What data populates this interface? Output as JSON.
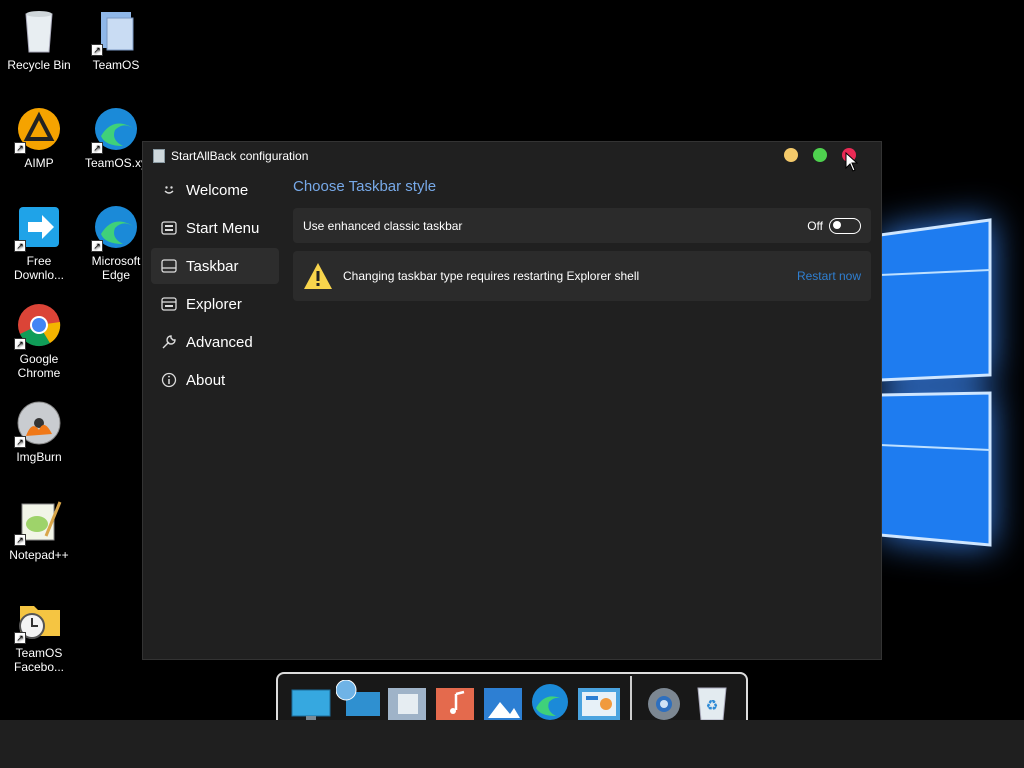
{
  "desktop": {
    "icons": [
      {
        "label": "Recycle Bin",
        "icon": "recycle-bin-icon"
      },
      {
        "label": "TeamOS",
        "icon": "teamos-icon"
      },
      {
        "label": "AIMP",
        "icon": "aimp-icon"
      },
      {
        "label": "TeamOS.xy",
        "icon": "edge-icon"
      },
      {
        "label": "Free Downlo...",
        "icon": "free-download-manager-icon"
      },
      {
        "label": "Microsoft Edge",
        "icon": "edge-icon"
      },
      {
        "label": "Google Chrome",
        "icon": "chrome-icon"
      },
      {
        "label": "ImgBurn",
        "icon": "imgburn-icon"
      },
      {
        "label": "Notepad++",
        "icon": "notepadpp-icon"
      },
      {
        "label": "TeamOS Facebo...",
        "icon": "folder-clock-icon"
      }
    ]
  },
  "window": {
    "title": "StartAllBack configuration",
    "controls": {
      "minimize": "#f3c96a",
      "maximize": "#4ed14e",
      "close": "#ea2a55"
    }
  },
  "sidebar": {
    "items": [
      {
        "label": "Welcome",
        "icon": "smile-icon",
        "active": false
      },
      {
        "label": "Start Menu",
        "icon": "start-menu-icon",
        "active": false
      },
      {
        "label": "Taskbar",
        "icon": "taskbar-icon",
        "active": true
      },
      {
        "label": "Explorer",
        "icon": "explorer-icon",
        "active": false
      },
      {
        "label": "Advanced",
        "icon": "wrench-icon",
        "active": false
      },
      {
        "label": "About",
        "icon": "info-icon",
        "active": false
      }
    ]
  },
  "main": {
    "section_title": "Choose Taskbar style",
    "enhanced_taskbar": {
      "label": "Use enhanced classic taskbar",
      "state": "Off"
    },
    "warning": {
      "text": "Changing taskbar type requires restarting Explorer shell",
      "action": "Restart now"
    }
  },
  "dock": {
    "items": [
      "desktop-icon",
      "network-icon",
      "files-icon",
      "music-icon",
      "photos-icon",
      "edge-icon",
      "control-panel-icon",
      "settings-gear-icon",
      "recycle-bin-icon"
    ]
  },
  "colors": {
    "accent": "#77a9e8",
    "link": "#2f7fd1",
    "window_bg": "#202020",
    "card_bg": "#2b2b2b"
  }
}
